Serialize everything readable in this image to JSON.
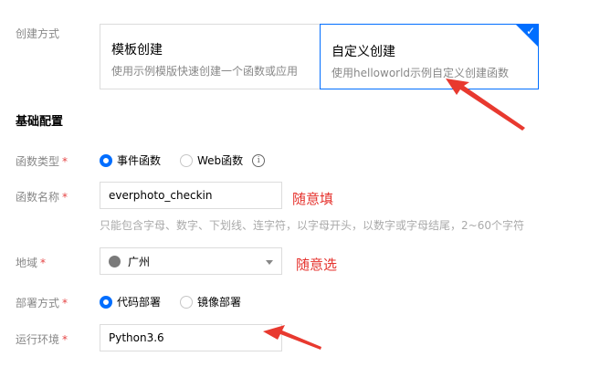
{
  "create_method": {
    "label": "创建方式",
    "options": [
      {
        "title": "模板创建",
        "desc": "使用示例模版快速创建一个函数或应用",
        "selected": false
      },
      {
        "title": "自定义创建",
        "desc": "使用helloworld示例自定义创建函数",
        "selected": true
      }
    ]
  },
  "section_title": "基础配置",
  "function_type": {
    "label": "函数类型",
    "required_mark": "*",
    "options": [
      "事件函数",
      "Web函数"
    ],
    "selected": "事件函数",
    "info_icon": "info-icon"
  },
  "function_name": {
    "label": "函数名称",
    "required_mark": "*",
    "value": "everphoto_checkin",
    "hint": "只能包含字母、数字、下划线、连字符，以字母开头，以数字或字母结尾，2~60个字符",
    "annotation": "随意填"
  },
  "region": {
    "label": "地域",
    "required_mark": "*",
    "value": "广州",
    "icon": "globe-icon",
    "annotation": "随意选"
  },
  "deploy_method": {
    "label": "部署方式",
    "required_mark": "*",
    "options": [
      "代码部署",
      "镜像部署"
    ],
    "selected": "代码部署"
  },
  "runtime": {
    "label": "运行环境",
    "required_mark": "*",
    "value": "Python3.6"
  },
  "colors": {
    "accent": "#006eff",
    "annotation": "#e5322d",
    "arrow": "#e8392f"
  }
}
